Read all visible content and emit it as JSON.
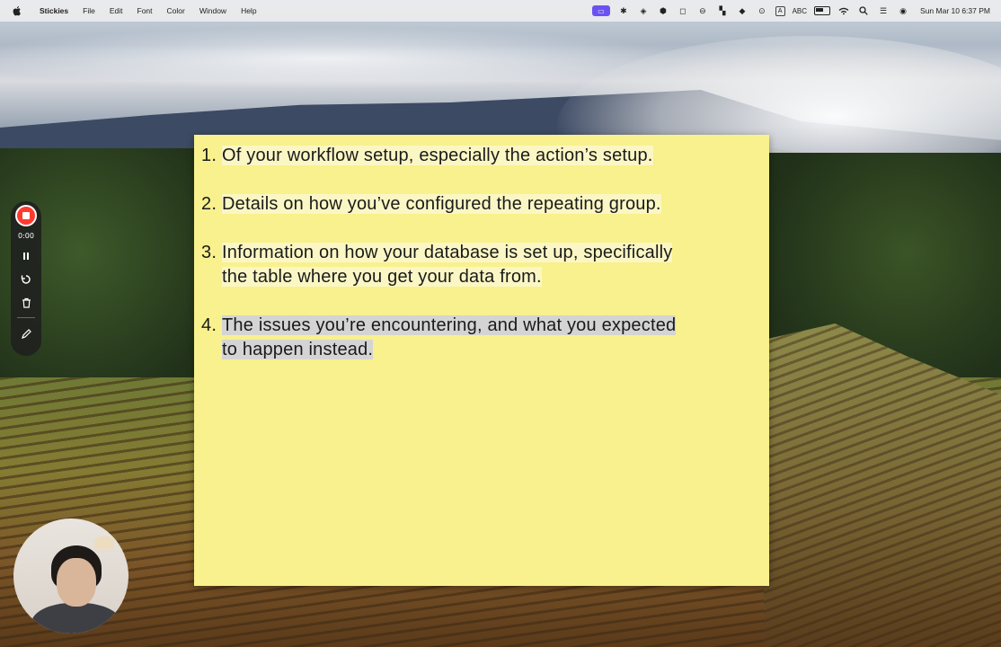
{
  "menubar": {
    "app_name": "Stickies",
    "menus": [
      "File",
      "Edit",
      "Font",
      "Color",
      "Window",
      "Help"
    ],
    "input_source": "A",
    "input_label": "ABC",
    "datetime": "Sun Mar 10  6:37 PM"
  },
  "sticky": {
    "background_color": "#f8f18d",
    "items": [
      {
        "num": "1.",
        "lines": [
          "Of your workflow setup, especially the action’s setup."
        ]
      },
      {
        "num": "2.",
        "lines": [
          "Details on how you’ve configured the repeating group."
        ]
      },
      {
        "num": "3.",
        "lines": [
          "Information on how your database is set up, specifically",
          "the table where you get your data from."
        ]
      },
      {
        "num": "4.",
        "lines": [
          "The issues you’re encountering, and what you expected",
          "to happen instead."
        ],
        "selected": true
      }
    ]
  },
  "recorder": {
    "time": "0:00",
    "icons": [
      "stop-record-icon",
      "pause-icon",
      "restart-icon",
      "trash-icon",
      "pencil-icon"
    ],
    "accent_color": "#ff3b30"
  }
}
